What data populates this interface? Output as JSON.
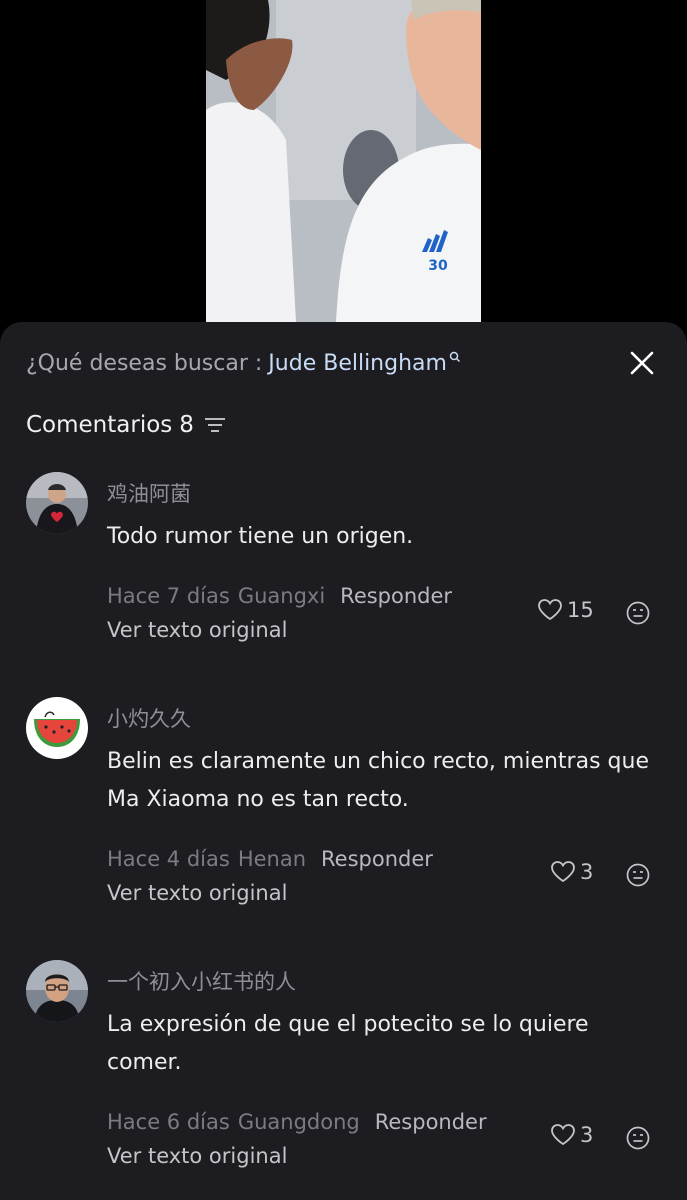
{
  "video": {
    "jersey_number": "30"
  },
  "search": {
    "prefix": "¿Qué deseas buscar :",
    "term": "Jude Bellingham"
  },
  "comments_header": {
    "label": "Comentarios",
    "count": "8"
  },
  "comments": [
    {
      "username": "鸡油阿菌",
      "text": "Todo rumor tiene un origen.",
      "time": "Hace 7 días",
      "region": "Guangxi",
      "reply_label": "Responder",
      "translate_label": "Ver texto original",
      "likes": "15"
    },
    {
      "username": "小灼久久",
      "text": "Belin es claramente un chico recto, mientras que Ma Xiaoma no es tan recto.",
      "time": "Hace 4 días",
      "region": "Henan",
      "reply_label": "Responder",
      "translate_label": "Ver texto original",
      "likes": "3"
    },
    {
      "username": "一个初入小红书的人",
      "text": "La expresión de que el potecito se lo quiere comer.",
      "time": "Hace 6 días",
      "region": "Guangdong",
      "reply_label": "Responder",
      "translate_label": "Ver texto original",
      "likes": "3"
    }
  ],
  "colors": {
    "sheet_bg": "#1c1c21",
    "search_term": "#c9dcf5",
    "muted": "#7b7b82"
  },
  "icons": [
    "search-icon",
    "close-icon",
    "sort-icon",
    "heart-icon",
    "emoji-icon"
  ]
}
